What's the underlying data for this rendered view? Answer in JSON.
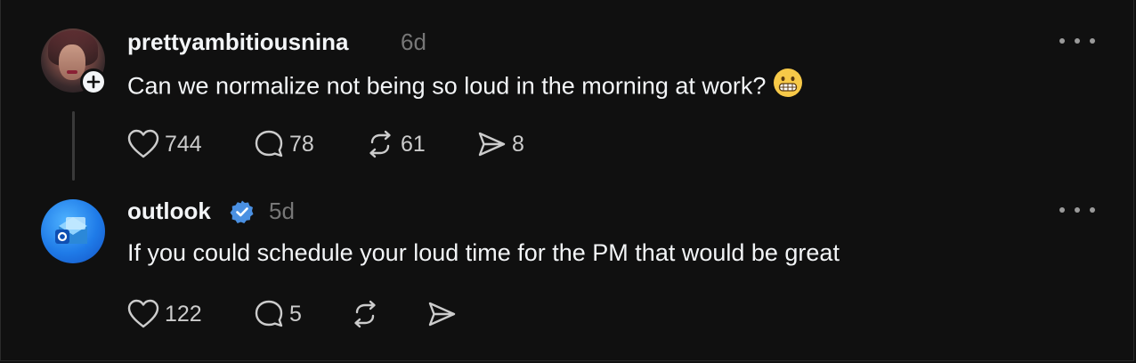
{
  "posts": [
    {
      "username": "prettyambitiousnina",
      "time": "6d",
      "text": "Can we normalize not being so loud in the morning at work?",
      "emoji": "grimacing-face",
      "likes": "744",
      "replies": "78",
      "reposts": "61",
      "shares": "8"
    },
    {
      "username": "outlook",
      "verified": true,
      "time": "5d",
      "text": "If you could schedule your loud time for the PM that would be great",
      "likes": "122",
      "replies": "5",
      "reposts": "",
      "shares": ""
    }
  ],
  "colors": {
    "background": "#101010",
    "text": "#f3f5f7",
    "muted": "#777777",
    "verified": "#4a90e2"
  }
}
